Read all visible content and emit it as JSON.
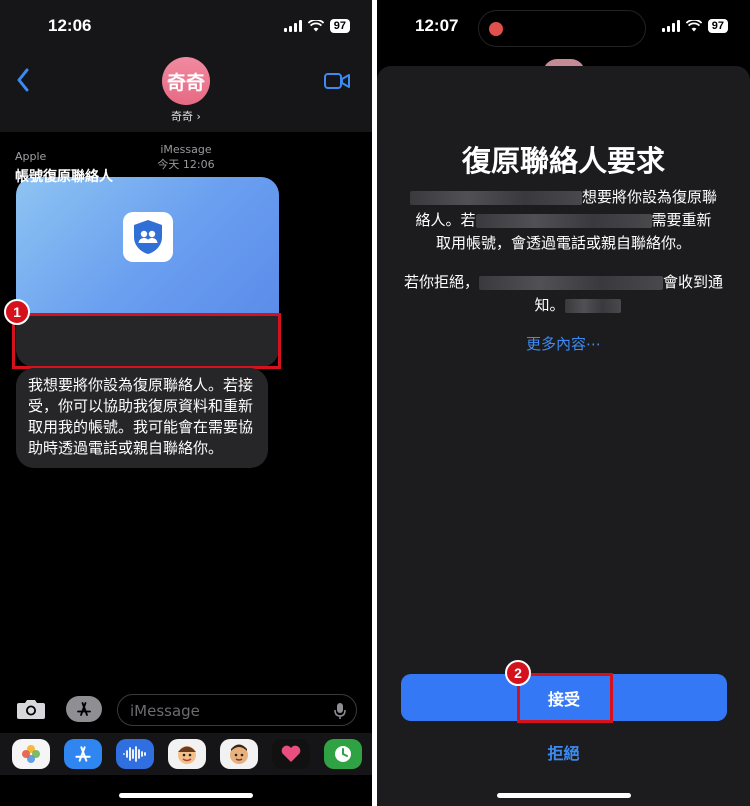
{
  "left": {
    "status": {
      "time": "12:06",
      "battery": "97"
    },
    "header": {
      "avatar_text": "奇奇",
      "contact_name": "奇奇 ›"
    },
    "meta": {
      "service": "iMessage",
      "timestamp": "今天 12:06"
    },
    "card": {
      "source": "Apple",
      "title": "帳號復原聯絡人"
    },
    "message": "我想要將你設為復原聯絡人。若接受，你可以協助我復原資料和重新取用我的帳號。我可能會在需要協助時透過電話或親自聯絡你。",
    "input": {
      "placeholder": "iMessage"
    },
    "step_badge": "1"
  },
  "right": {
    "status": {
      "time": "12:07",
      "battery": "97"
    },
    "title": "復原聯絡人要求",
    "para1_a": "想要將你設為復原聯",
    "para1_b": "絡人。若",
    "para1_c": "需要重新",
    "para1_d": "取用帳號，會透過電話或親自聯絡你。",
    "para2_a": "若你拒絕，",
    "para2_b": "會收到通",
    "para2_c": "知。",
    "more": "更多內容⋯",
    "accept": "接受",
    "decline": "拒絕",
    "step_badge": "2"
  },
  "colors": {
    "accent": "#3478f6",
    "highlight": "#d4111c",
    "bubble": "#262629"
  }
}
